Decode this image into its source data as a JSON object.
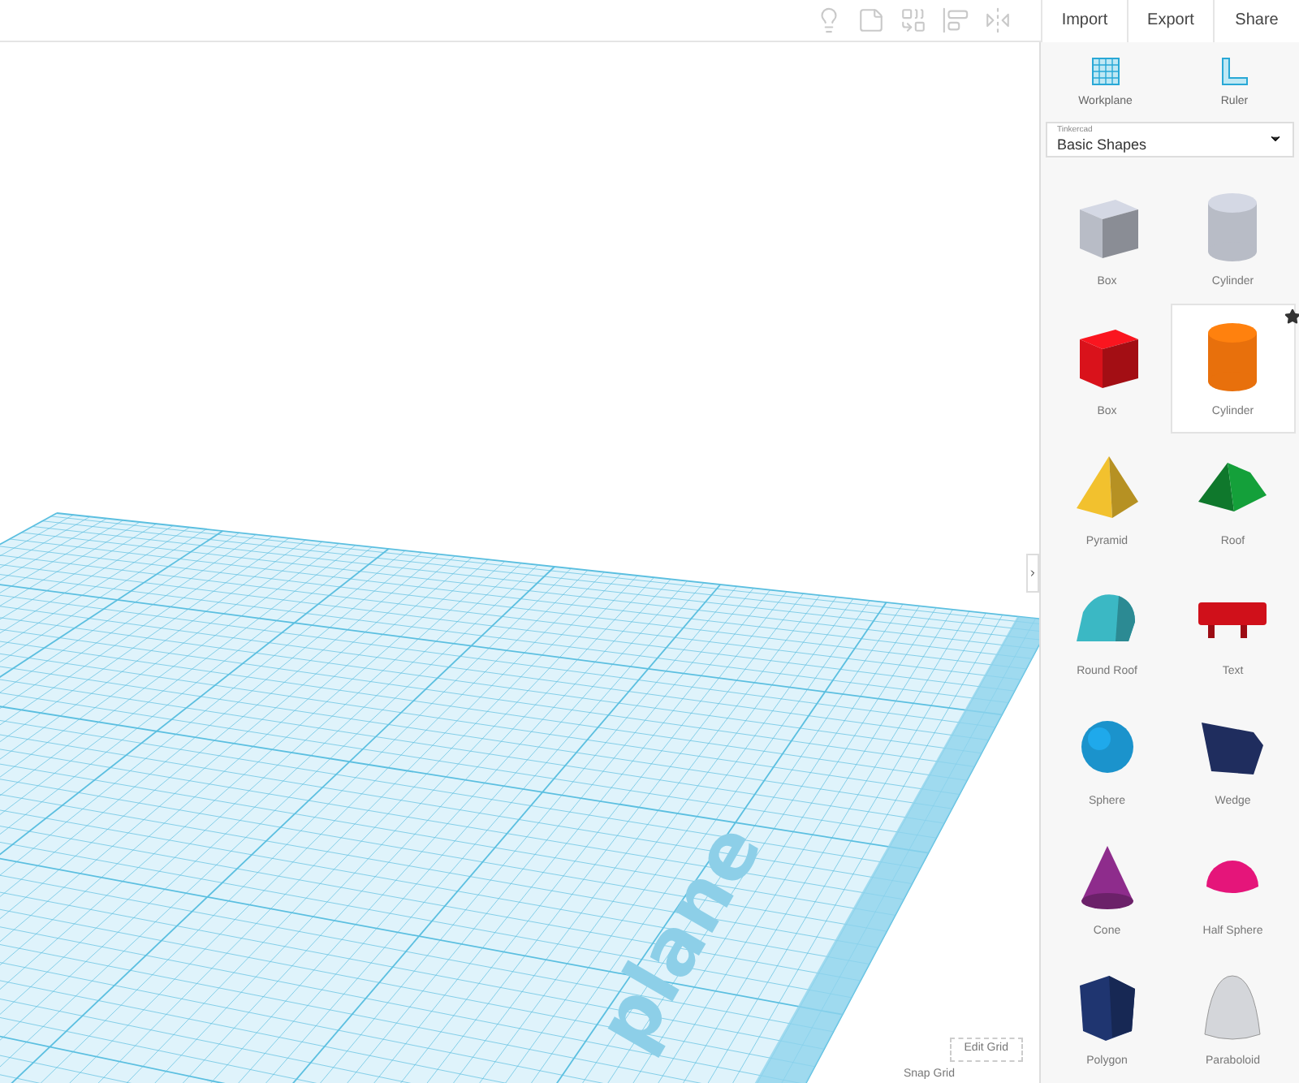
{
  "toolbar": {
    "tools": [
      {
        "kind": "bulb",
        "disabled": true
      },
      {
        "kind": "note",
        "disabled": true
      },
      {
        "kind": "group",
        "disabled": true
      },
      {
        "kind": "align",
        "disabled": true
      },
      {
        "kind": "mirror",
        "disabled": true
      }
    ],
    "buttons": [
      "Import",
      "Export",
      "Share"
    ]
  },
  "panel": {
    "tools": [
      {
        "kind": "workplane",
        "label": "Workplane"
      },
      {
        "kind": "ruler",
        "label": "Ruler"
      }
    ],
    "library": {
      "caption": "Tinkercad",
      "value": "Basic Shapes"
    },
    "shapes": [
      {
        "kind": "box",
        "label": "Box",
        "color": "#b8bcc6",
        "hovered": false
      },
      {
        "kind": "cylinder",
        "label": "Cylinder",
        "color": "#b8bcc6",
        "hovered": false
      },
      {
        "kind": "box",
        "label": "Box",
        "color": "#d9121b",
        "hovered": false
      },
      {
        "kind": "cylinder",
        "label": "Cylinder",
        "color": "#e8700c",
        "hovered": true
      },
      {
        "kind": "pyramid",
        "label": "Pyramid",
        "color": "#f2c12e",
        "hovered": false
      },
      {
        "kind": "roof",
        "label": "Roof",
        "color": "#14a03a",
        "hovered": false
      },
      {
        "kind": "roundroof",
        "label": "Round Roof",
        "color": "#3bb8c4",
        "hovered": false
      },
      {
        "kind": "text",
        "label": "Text",
        "color": "#d0101a",
        "hovered": false
      },
      {
        "kind": "sphere",
        "label": "Sphere",
        "color": "#1b93cc",
        "hovered": false
      },
      {
        "kind": "wedge",
        "label": "Wedge",
        "color": "#1f2d5e",
        "hovered": false
      },
      {
        "kind": "cone",
        "label": "Cone",
        "color": "#8e2c8c",
        "hovered": false
      },
      {
        "kind": "halfsphere",
        "label": "Half Sphere",
        "color": "#e5157a",
        "hovered": false
      },
      {
        "kind": "polygon",
        "label": "Polygon",
        "color": "#1f3570",
        "hovered": false
      },
      {
        "kind": "paraboloid",
        "label": "Paraboloid",
        "color": "#d4d6da",
        "hovered": false
      }
    ]
  },
  "canvas": {
    "workplane_label": "plane",
    "edit_grid": "Edit Grid",
    "snap_grid": "Snap Grid"
  }
}
